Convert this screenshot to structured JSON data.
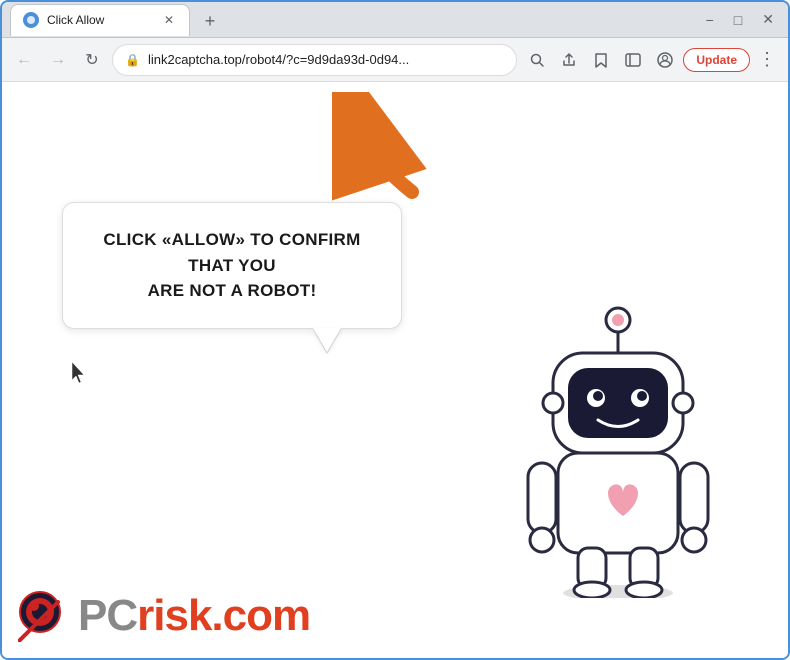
{
  "browser": {
    "tab": {
      "title": "Click Allow",
      "favicon_color": "#4a90d9"
    },
    "url": "link2captcha.top/robot4/?c=9d9da93d-0d94...",
    "update_button": "Update"
  },
  "page": {
    "bubble_line1": "CLICK «ALLOW» TO CONFIRM THAT YOU",
    "bubble_line2": "ARE NOT A ROBOT!",
    "pcrisk_pc": "PC",
    "pcrisk_risk": "risk",
    "pcrisk_domain": ".com"
  },
  "icons": {
    "back": "←",
    "forward": "→",
    "refresh": "↻",
    "lock": "🔒",
    "search": "⌕",
    "share": "↗",
    "bookmark": "☆",
    "sidebar": "▭",
    "profile": "○",
    "menu": "⋮",
    "close": "✕",
    "new_tab": "+"
  }
}
